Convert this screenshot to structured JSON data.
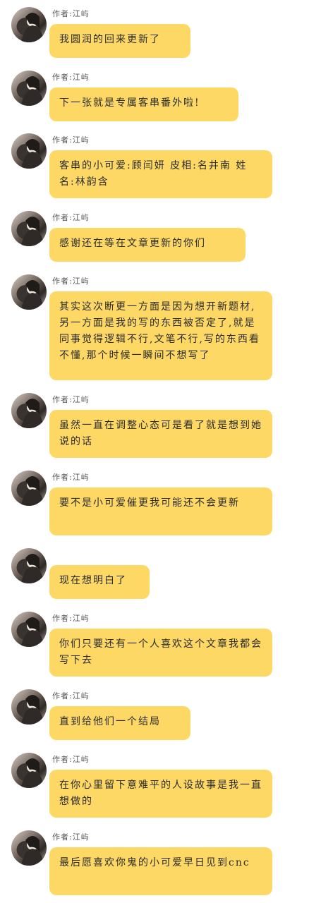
{
  "messages": [
    {
      "author": "作者:江屿",
      "text": "我圆润的回来更新了"
    },
    {
      "author": "作者:江屿",
      "text": "下一张就是专属客串番外啦!"
    },
    {
      "author": "作者:江屿",
      "text": "客串的小可爱:顾闫妍 皮相:名井南 姓名:林韵含"
    },
    {
      "author": "作者:江屿",
      "text": "感谢还在等在文章更新的你们"
    },
    {
      "author": "作者:江屿",
      "text": "其实这次断更一方面是因为想开新题材,另一方面是我的写的东西被否定了,就是同事觉得逻辑不行,文笔不行,写的东西看不懂,那个时候一瞬间不想写了"
    },
    {
      "author": "作者:江屿",
      "text": "虽然一直在调整心态可是看了就是想到她说的话"
    },
    {
      "author": "作者:江屿",
      "text": "要不是小可爱催更我可能还不会更新"
    },
    {
      "author": "作者:江屿",
      "text": "现在想明白了"
    },
    {
      "author": "作者:江屿",
      "text": "你们只要还有一个人喜欢这个文章我都会写下去"
    },
    {
      "author": "作者:江屿",
      "text": "直到给他们一个结局"
    },
    {
      "author": "作者:江屿",
      "text": "在你心里留下意难平的人设故事是我一直想做的"
    },
    {
      "author": "作者:江屿",
      "text": "最后愿喜欢你鬼的小可爱早日见到cnc"
    }
  ]
}
